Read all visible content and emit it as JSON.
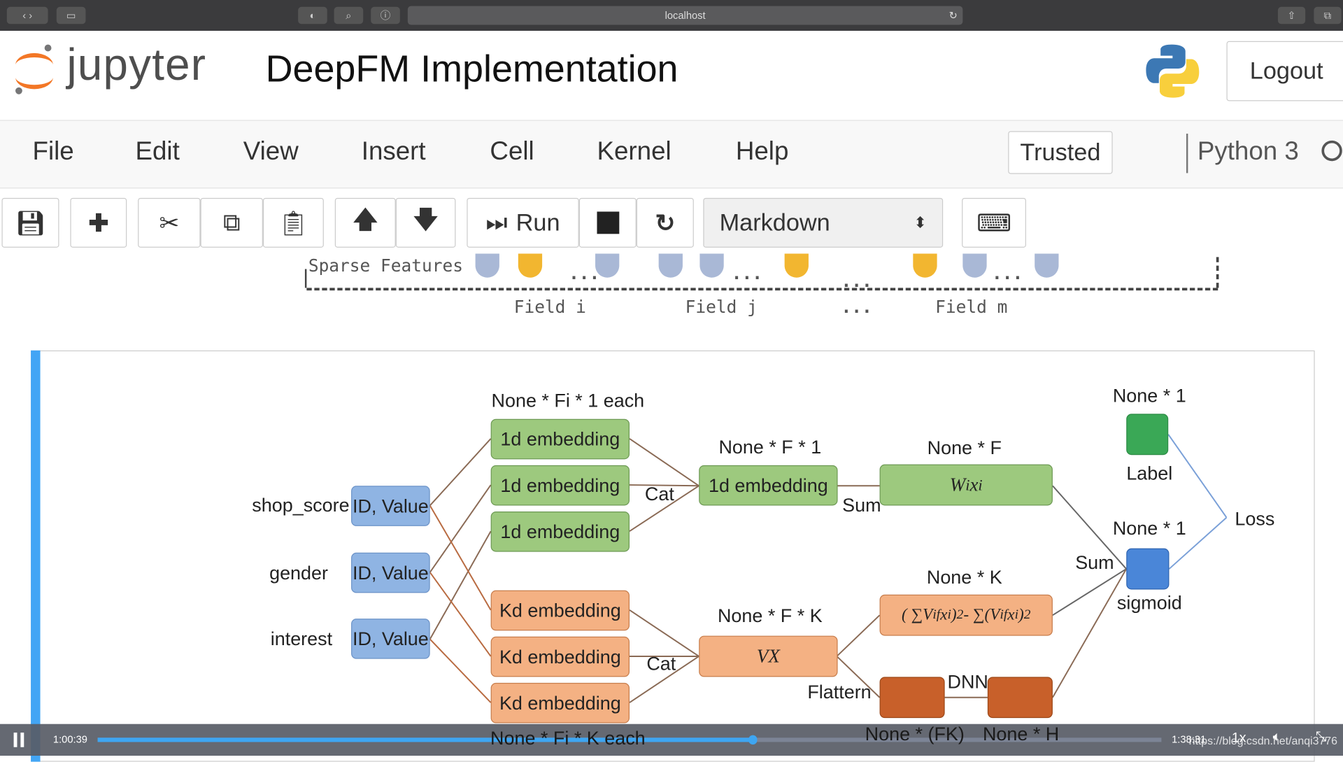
{
  "browser": {
    "url": "localhost"
  },
  "header": {
    "logo_text": "jupyter",
    "title": "DeepFM Implementation",
    "logout": "Logout"
  },
  "menu": {
    "items": [
      "File",
      "Edit",
      "View",
      "Insert",
      "Cell",
      "Kernel",
      "Help"
    ],
    "trusted": "Trusted",
    "kernel": "Python 3"
  },
  "toolbar": {
    "run": "Run",
    "cell_type": "Markdown"
  },
  "sparse": {
    "label": "Sparse Features",
    "fields": [
      "Field i",
      "Field j",
      "...",
      "Field m"
    ],
    "dots": "···",
    "ellipsis": "..."
  },
  "diagram": {
    "features": [
      "shop_score",
      "gender",
      "interest"
    ],
    "id_value": "ID, Value",
    "emb_1d": "1d embedding",
    "emb_kd": "Kd embedding",
    "shape_fi1": "None * Fi * 1 each",
    "shape_fik": "None * Fi * K each",
    "shape_f1": "None * F * 1",
    "shape_fk": "None * F * K",
    "shape_f": "None * F",
    "shape_k": "None * K",
    "shape_1a": "None * 1",
    "shape_1b": "None * 1",
    "shape_fk2": "None * (FK)",
    "shape_h": "None * H",
    "cat1": "Cat",
    "cat2": "Cat",
    "sum1": "Sum",
    "sum2": "Sum",
    "wx": "W_i x_i",
    "vx": "VX",
    "fm": "( ∑V_if x_i)² - ∑(V_if x_i)²",
    "flatten": "Flattern",
    "dnn": "DNN",
    "label": "Label",
    "sigmoid": "sigmoid",
    "loss": "Loss"
  },
  "colors": {
    "green": "#9dc97e",
    "orange": "#f4b183",
    "dark_orange": "#c8602a",
    "blue": "#8fb4e3",
    "label_green": "#3aa856",
    "sigmoid_blue": "#4a86d8",
    "progress": "#3ea6f2"
  },
  "video": {
    "current": "1:00:39",
    "total": "1:38:31",
    "speed": "1x",
    "progress": 0.616,
    "watermark": "https://blog.csdn.net/anqi3776"
  }
}
